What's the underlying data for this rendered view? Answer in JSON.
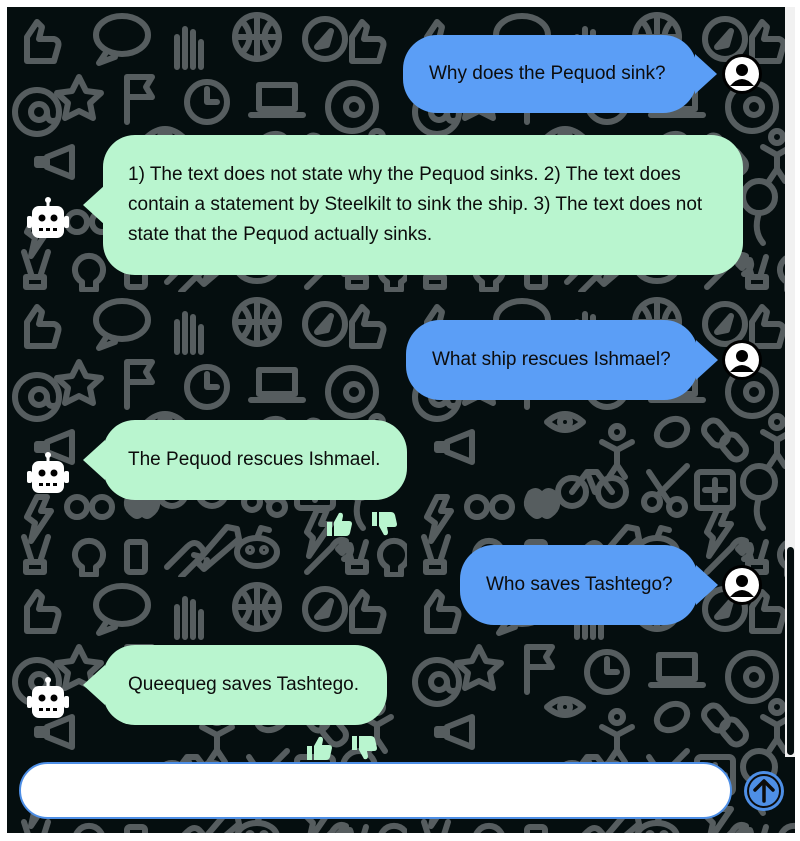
{
  "conversation": {
    "messages": [
      {
        "role": "user",
        "text": "Why does the Pequod sink?"
      },
      {
        "role": "bot",
        "text": "1) The text does not state why the Pequod sinks. 2) The text does contain a statement by Steelkilt to sink the ship. 3) The text does not state that the Pequod actually sinks."
      },
      {
        "role": "user",
        "text": "What ship rescues Ishmael?"
      },
      {
        "role": "bot",
        "text": "The Pequod rescues Ishmael."
      },
      {
        "role": "user",
        "text": "Who saves Tashtego?"
      },
      {
        "role": "bot",
        "text": "Queequeg saves Tashtego."
      }
    ]
  },
  "composer": {
    "value": "",
    "placeholder": ""
  },
  "icons": {
    "user_avatar": "user-circle-icon",
    "bot_avatar": "robot-icon",
    "like": "thumbs-up-icon",
    "dislike": "thumbs-down-icon",
    "send": "arrow-up-icon"
  },
  "colors": {
    "background": "#050e0f",
    "wallpaper_icons": "#5a6163",
    "user_bubble": "#5b9ef6",
    "bot_bubble": "#b9f5cf",
    "reaction": "#b9f5cf",
    "accent": "#4e8fe6"
  }
}
